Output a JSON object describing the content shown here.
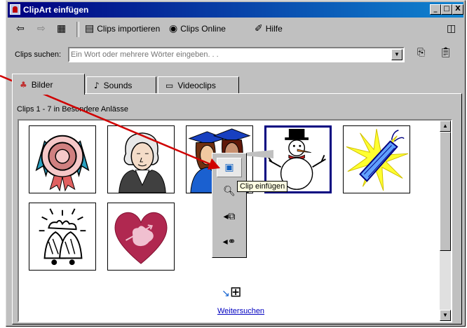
{
  "window": {
    "title": "ClipArt einfügen"
  },
  "title_buttons": {
    "minimize": "_",
    "maximize": "□",
    "close": "X"
  },
  "toolbar": {
    "back_icon": "⇦",
    "forward_icon": "⇨",
    "grid_icon": "▦",
    "import_label": "Clips importieren",
    "online_label": "Clips Online",
    "help_label": "Hilfe",
    "pin_icon": "◫"
  },
  "search": {
    "label": "Clips suchen:",
    "placeholder": "Ein Wort oder mehrere Wörter eingeben. . ."
  },
  "tabs": [
    {
      "label": "Bilder",
      "icon": "♣"
    },
    {
      "label": "Sounds",
      "icon": "♪"
    },
    {
      "label": "Videoclips",
      "icon": "▭"
    }
  ],
  "gallery": {
    "header": "Clips 1 - 7 in Besondere Anlässe",
    "more_link": "Weitersuchen",
    "clips": [
      {
        "name": "ribbon-award"
      },
      {
        "name": "george-washington"
      },
      {
        "name": "graduates"
      },
      {
        "name": "snowman"
      },
      {
        "name": "firecracker"
      },
      {
        "name": "bells"
      },
      {
        "name": "heart-cupid"
      }
    ]
  },
  "popup_menu": {
    "tooltip": "Clip einfügen"
  },
  "colors": {
    "titlebar": "#000080",
    "selection": "#000080",
    "link": "#0000c0",
    "tooltip_bg": "#ffffe1",
    "annotation_arrow": "#d00000"
  }
}
